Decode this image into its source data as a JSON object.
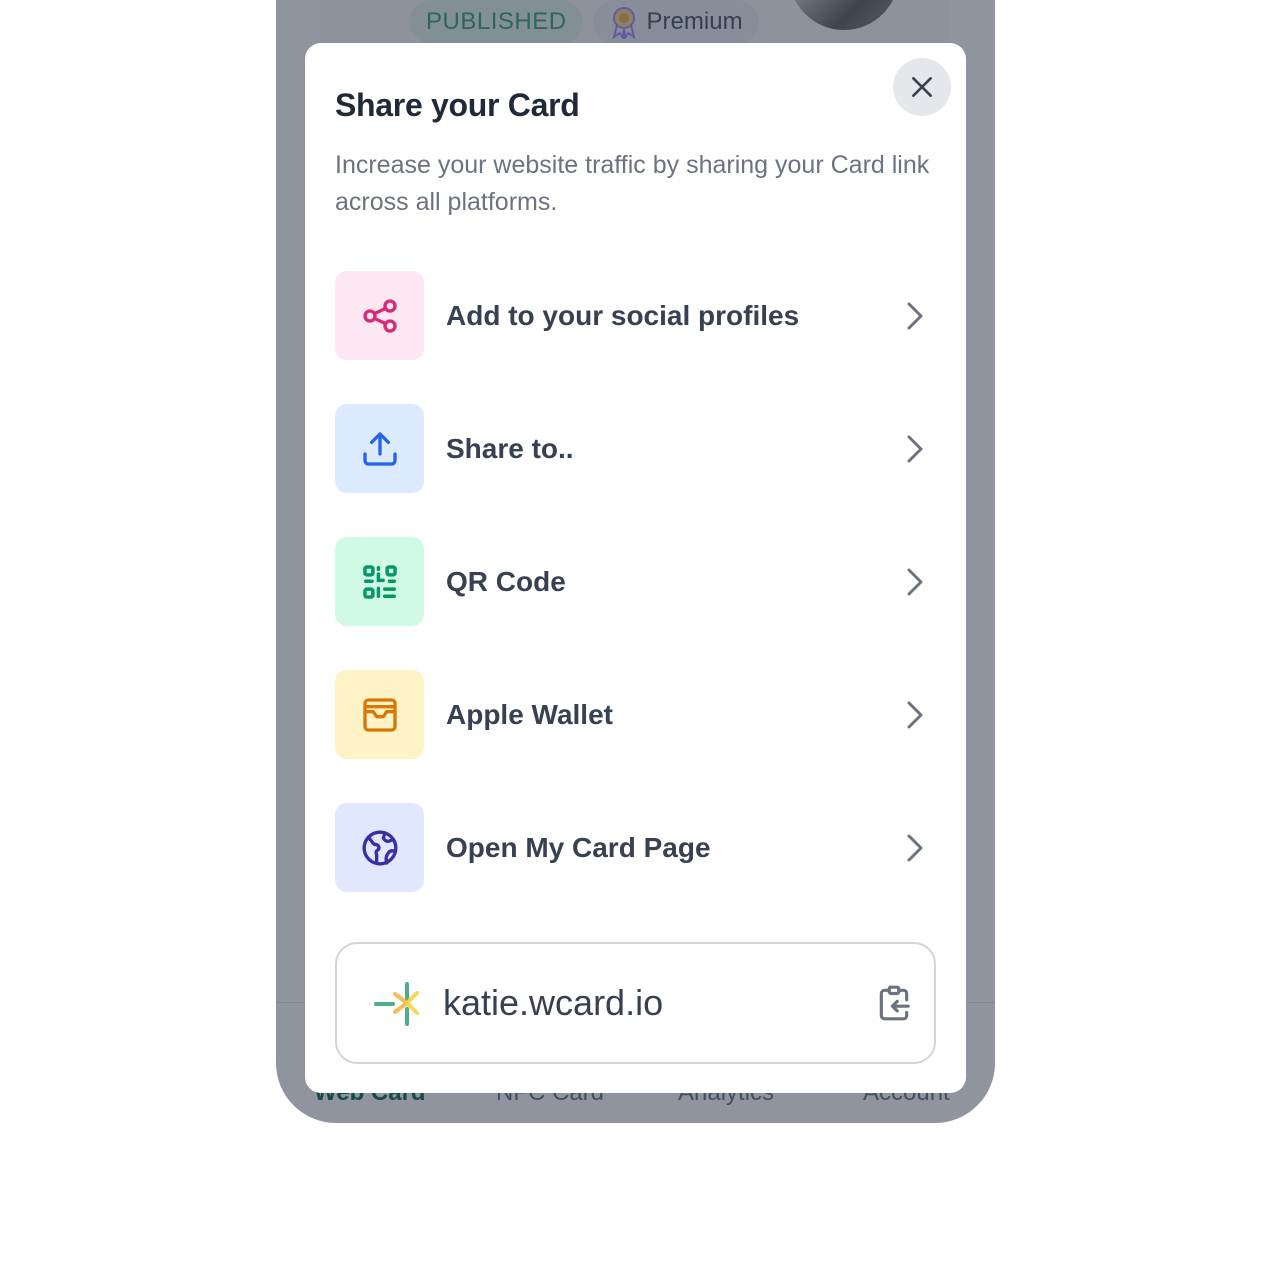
{
  "background": {
    "status_badge": "PUBLISHED",
    "plan_badge": "Premium",
    "bottom_nav": [
      {
        "label": "Web Card",
        "active": true
      },
      {
        "label": "NFC Card",
        "active": false
      },
      {
        "label": "Analytics",
        "active": false
      },
      {
        "label": "Account",
        "active": false
      }
    ]
  },
  "modal": {
    "title": "Share your Card",
    "description": "Increase your website traffic by sharing your Card link across all platforms.",
    "close_icon": "close-icon",
    "options": [
      {
        "label": "Add to your social profiles",
        "icon": "share-nodes-icon",
        "icon_color": "#db2777",
        "icon_bg": "#fce7f3"
      },
      {
        "label": "Share to..",
        "icon": "upload-icon",
        "icon_color": "#2563eb",
        "icon_bg": "#dbeafe"
      },
      {
        "label": "QR Code",
        "icon": "qr-code-icon",
        "icon_color": "#059669",
        "icon_bg": "#d1fae5"
      },
      {
        "label": "Apple Wallet",
        "icon": "wallet-icon",
        "icon_color": "#d97706",
        "icon_bg": "#fef3c7"
      },
      {
        "label": "Open My Card Page",
        "icon": "globe-icon",
        "icon_color": "#3730a3",
        "icon_bg": "#e0e7ff"
      }
    ],
    "link": {
      "url": "katie.wcard.io",
      "copy_icon": "clipboard-copy-icon"
    }
  }
}
